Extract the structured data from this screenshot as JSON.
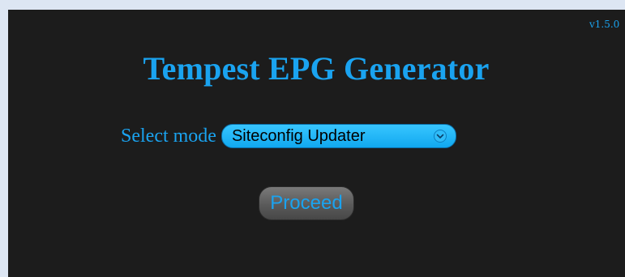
{
  "app": {
    "version": "v1.5.0",
    "title": "Tempest EPG Generator"
  },
  "mode": {
    "label": "Select mode",
    "selected": "Siteconfig Updater",
    "icon": "chevron-down-icon"
  },
  "actions": {
    "proceed_label": "Proceed"
  },
  "colors": {
    "accent": "#1aa3f0",
    "panel_bg": "#1c1c1c",
    "page_bg": "#dde6f3",
    "select_bg": "#1fb2f5",
    "button_bg": "#5a5a5a"
  }
}
